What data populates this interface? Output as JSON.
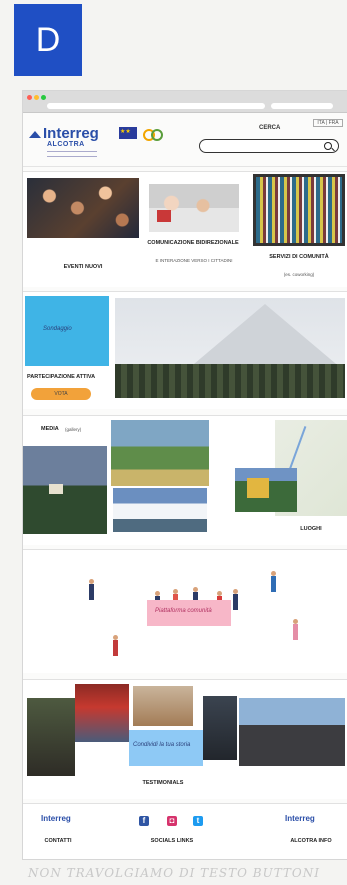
{
  "badge": "D",
  "header": {
    "brand": "Interreg",
    "sub": "ALCOTRA",
    "search_label": "CERCA",
    "lang": "ITA | FRA"
  },
  "sections": {
    "eventi": "EVENTI NUOVI",
    "comunicazione": "COMUNICAZIONE BIDIREZIONALE",
    "comunicazione_sub": "E INTERAZIONE VERSO I CITTADINI",
    "servizi": "SERVIZI DI COMUNITÀ",
    "servizi_sub": "(es. coworking)",
    "postit": "Sondaggio",
    "partecipazione": "PARTECIPAZIONE ATTIVA",
    "partecipazione_btn": "VOTA",
    "media": "MEDIA",
    "media_sub": "(gallery)",
    "luoghi": "LUOGHI",
    "banner": "Piattaforma comunità",
    "testimonials": "TESTIMONIALS",
    "testimonial_note": "Condividi la tua storia"
  },
  "footer": {
    "logo": "Interreg",
    "logo_sub": "ALCOTRA",
    "contatti": "CONTATTI",
    "socials": "SOCIALS Links",
    "info": "ALCOTRA INFO",
    "fb": "f",
    "ig": "◘",
    "tw": "t"
  },
  "handwriting": "NON TRAVOLGIAMO DI TESTO BUTTONI"
}
